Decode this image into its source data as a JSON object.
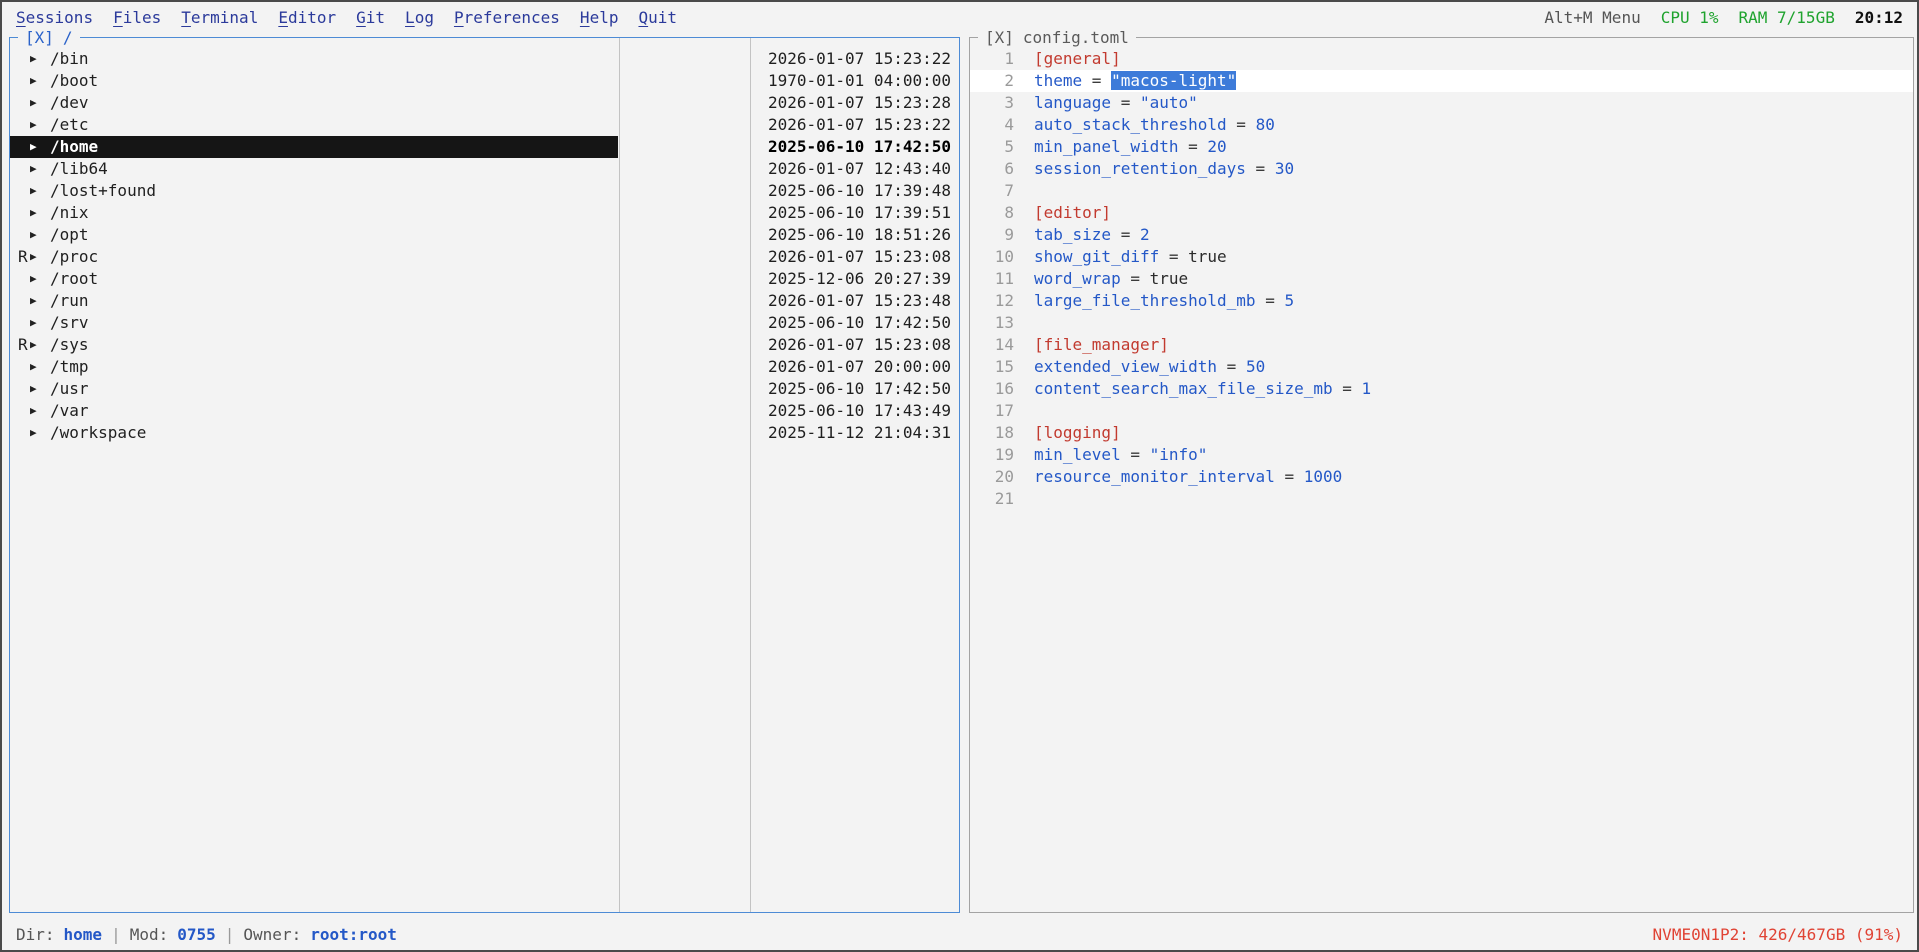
{
  "menu": {
    "items": [
      {
        "label": "Sessions"
      },
      {
        "label": "Files"
      },
      {
        "label": "Terminal"
      },
      {
        "label": "Editor"
      },
      {
        "label": "Git"
      },
      {
        "label": "Log"
      },
      {
        "label": "Preferences"
      },
      {
        "label": "Help"
      },
      {
        "label": "Quit"
      }
    ],
    "right_hint": "Alt+M Menu",
    "cpu": "CPU 1%",
    "ram": "RAM 7/15GB",
    "clock": "20:12"
  },
  "file_panel": {
    "close_label": "[X]",
    "title": "/",
    "arrow_glyph": "▶",
    "rows": [
      {
        "flag": "",
        "name": "/bin",
        "mtime": "2026-01-07 15:23:22",
        "selected": false
      },
      {
        "flag": "",
        "name": "/boot",
        "mtime": "1970-01-01 04:00:00",
        "selected": false
      },
      {
        "flag": "",
        "name": "/dev",
        "mtime": "2026-01-07 15:23:28",
        "selected": false
      },
      {
        "flag": "",
        "name": "/etc",
        "mtime": "2026-01-07 15:23:22",
        "selected": false
      },
      {
        "flag": "",
        "name": "/home",
        "mtime": "2025-06-10 17:42:50",
        "selected": true
      },
      {
        "flag": "",
        "name": "/lib64",
        "mtime": "2026-01-07 12:43:40",
        "selected": false
      },
      {
        "flag": "",
        "name": "/lost+found",
        "mtime": "2025-06-10 17:39:48",
        "selected": false
      },
      {
        "flag": "",
        "name": "/nix",
        "mtime": "2025-06-10 17:39:51",
        "selected": false
      },
      {
        "flag": "",
        "name": "/opt",
        "mtime": "2025-06-10 18:51:26",
        "selected": false
      },
      {
        "flag": "R",
        "name": "/proc",
        "mtime": "2026-01-07 15:23:08",
        "selected": false
      },
      {
        "flag": "",
        "name": "/root",
        "mtime": "2025-12-06 20:27:39",
        "selected": false
      },
      {
        "flag": "",
        "name": "/run",
        "mtime": "2026-01-07 15:23:48",
        "selected": false
      },
      {
        "flag": "",
        "name": "/srv",
        "mtime": "2025-06-10 17:42:50",
        "selected": false
      },
      {
        "flag": "R",
        "name": "/sys",
        "mtime": "2026-01-07 15:23:08",
        "selected": false
      },
      {
        "flag": "",
        "name": "/tmp",
        "mtime": "2026-01-07 20:00:00",
        "selected": false
      },
      {
        "flag": "",
        "name": "/usr",
        "mtime": "2025-06-10 17:42:50",
        "selected": false
      },
      {
        "flag": "",
        "name": "/var",
        "mtime": "2025-06-10 17:43:49",
        "selected": false
      },
      {
        "flag": "",
        "name": "/workspace",
        "mtime": "2025-11-12 21:04:31",
        "selected": false
      }
    ]
  },
  "editor_panel": {
    "close_label": "[X]",
    "title": "config.toml",
    "lines": [
      {
        "num": 1,
        "current": false,
        "tokens": [
          {
            "t": "section",
            "v": "[general]"
          }
        ]
      },
      {
        "num": 2,
        "current": true,
        "tokens": [
          {
            "t": "key",
            "v": "theme"
          },
          {
            "t": "op",
            "v": " = "
          },
          {
            "t": "sel",
            "v": "\"macos-light\""
          }
        ]
      },
      {
        "num": 3,
        "current": false,
        "tokens": [
          {
            "t": "key",
            "v": "language"
          },
          {
            "t": "op",
            "v": " = "
          },
          {
            "t": "str",
            "v": "\"auto\""
          }
        ]
      },
      {
        "num": 4,
        "current": false,
        "tokens": [
          {
            "t": "key",
            "v": "auto_stack_threshold"
          },
          {
            "t": "op",
            "v": " = "
          },
          {
            "t": "num",
            "v": "80"
          }
        ]
      },
      {
        "num": 5,
        "current": false,
        "tokens": [
          {
            "t": "key",
            "v": "min_panel_width"
          },
          {
            "t": "op",
            "v": " = "
          },
          {
            "t": "num",
            "v": "20"
          }
        ]
      },
      {
        "num": 6,
        "current": false,
        "tokens": [
          {
            "t": "key",
            "v": "session_retention_days"
          },
          {
            "t": "op",
            "v": " = "
          },
          {
            "t": "num",
            "v": "30"
          }
        ]
      },
      {
        "num": 7,
        "current": false,
        "tokens": []
      },
      {
        "num": 8,
        "current": false,
        "tokens": [
          {
            "t": "section",
            "v": "[editor]"
          }
        ]
      },
      {
        "num": 9,
        "current": false,
        "tokens": [
          {
            "t": "key",
            "v": "tab_size"
          },
          {
            "t": "op",
            "v": " = "
          },
          {
            "t": "num",
            "v": "2"
          }
        ]
      },
      {
        "num": 10,
        "current": false,
        "tokens": [
          {
            "t": "key",
            "v": "show_git_diff"
          },
          {
            "t": "op",
            "v": " = "
          },
          {
            "t": "bool",
            "v": "true"
          }
        ]
      },
      {
        "num": 11,
        "current": false,
        "tokens": [
          {
            "t": "key",
            "v": "word_wrap"
          },
          {
            "t": "op",
            "v": " = "
          },
          {
            "t": "bool",
            "v": "true"
          }
        ]
      },
      {
        "num": 12,
        "current": false,
        "tokens": [
          {
            "t": "key",
            "v": "large_file_threshold_mb"
          },
          {
            "t": "op",
            "v": " = "
          },
          {
            "t": "num",
            "v": "5"
          }
        ]
      },
      {
        "num": 13,
        "current": false,
        "tokens": []
      },
      {
        "num": 14,
        "current": false,
        "tokens": [
          {
            "t": "section",
            "v": "[file_manager]"
          }
        ]
      },
      {
        "num": 15,
        "current": false,
        "tokens": [
          {
            "t": "key",
            "v": "extended_view_width"
          },
          {
            "t": "op",
            "v": " = "
          },
          {
            "t": "num",
            "v": "50"
          }
        ]
      },
      {
        "num": 16,
        "current": false,
        "tokens": [
          {
            "t": "key",
            "v": "content_search_max_file_size_mb"
          },
          {
            "t": "op",
            "v": " = "
          },
          {
            "t": "num",
            "v": "1"
          }
        ]
      },
      {
        "num": 17,
        "current": false,
        "tokens": []
      },
      {
        "num": 18,
        "current": false,
        "tokens": [
          {
            "t": "section",
            "v": "[logging]"
          }
        ]
      },
      {
        "num": 19,
        "current": false,
        "tokens": [
          {
            "t": "key",
            "v": "min_level"
          },
          {
            "t": "op",
            "v": " = "
          },
          {
            "t": "str",
            "v": "\"info\""
          }
        ]
      },
      {
        "num": 20,
        "current": false,
        "tokens": [
          {
            "t": "key",
            "v": "resource_monitor_interval"
          },
          {
            "t": "op",
            "v": " = "
          },
          {
            "t": "num",
            "v": "1000"
          }
        ]
      },
      {
        "num": 21,
        "current": false,
        "tokens": []
      }
    ]
  },
  "status_bar": {
    "dir_label": "Dir:",
    "dir_value": "home",
    "sep": "|",
    "mod_label": "Mod:",
    "mod_value": "0755",
    "owner_label": "Owner:",
    "owner_value": "root:root",
    "disk": "NVME0N1P2: 426/467GB (91%)"
  },
  "colors": {
    "accent_blue": "#2458c7",
    "selection_blue": "#3d7bd9",
    "section_red": "#c23a2f",
    "status_green": "#1fa32e",
    "alert_red": "#e04334",
    "panel_border_blue": "#4d8bd5"
  }
}
